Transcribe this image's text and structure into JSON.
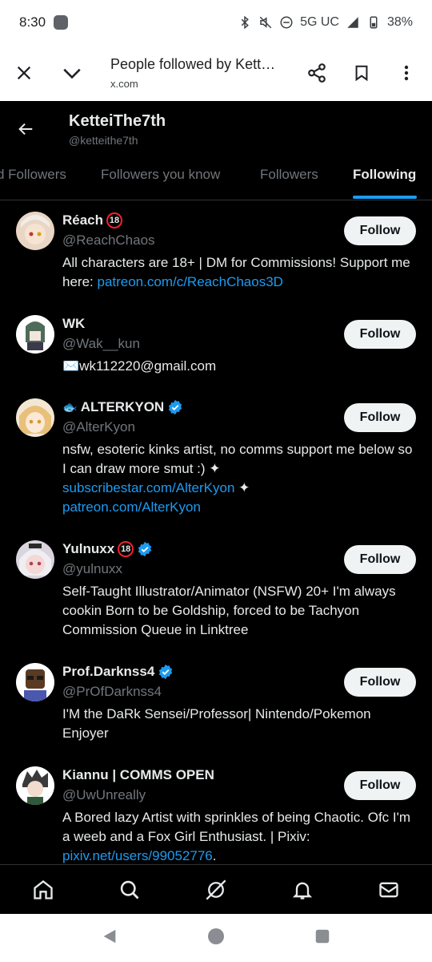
{
  "status_bar": {
    "time": "8:30",
    "network": "5G UC",
    "battery": "38%"
  },
  "browser": {
    "title": "People followed by Kett…",
    "url": "x.com"
  },
  "header": {
    "name": "KetteiThe7th",
    "handle": "@ketteithe7th"
  },
  "tabs": [
    {
      "label": "d Followers",
      "active": false
    },
    {
      "label": "Followers you know",
      "active": false
    },
    {
      "label": "Followers",
      "active": false
    },
    {
      "label": "Following",
      "active": true
    }
  ],
  "users": [
    {
      "name": "Réach",
      "badge18": "18",
      "verified": false,
      "handle": "@ReachChaos",
      "bio": "All characters are 18+ | DM for Commissions! Support me here: ",
      "bio_link": "patreon.com/c/ReachChaos3D",
      "follow_label": "Follow"
    },
    {
      "name": "WK",
      "badge18": "",
      "verified": false,
      "handle": "@Wak__kun",
      "bio": "✉️wk112220@gmail.com",
      "follow_label": "Follow"
    },
    {
      "name": "ALTERKYON",
      "name_prefix": "🐟",
      "verified": true,
      "handle": "@AlterKyon",
      "bio": "nsfw, esoteric kinks artist, no comms support me below so I can draw more smut :) ✦",
      "bio_link_1": "subscribestar.com/AlterKyon",
      "bio_sep": " ✦",
      "bio_link_2": "patreon.com/AlterKyon",
      "follow_label": "Follow"
    },
    {
      "name": "Yulnuxx",
      "badge18": "18",
      "verified": true,
      "handle": "@yulnuxx",
      "bio": "Self-Taught Illustrator/Animator (NSFW) 20+ I'm always cookin Born to be Goldship, forced to be Tachyon Commission Queue in Linktree",
      "follow_label": "Follow"
    },
    {
      "name": "Prof.Darknss4",
      "verified": true,
      "handle": "@PrOfDarknss4",
      "bio": "I'M the DaRk Sensei/Professor| Nintendo/Pokemon Enjoyer",
      "follow_label": "Follow"
    },
    {
      "name": "Kiannu | COMMS OPEN",
      "verified": false,
      "handle": "@UwUnreally",
      "bio": "A Bored lazy Artist with sprinkles of being Chaotic. Ofc I'm a weeb and a Fox Girl Enthusiast. | Pixiv: ",
      "bio_link": "pixiv.net/users/99052776",
      "bio_end": ".",
      "follow_label": "Follow"
    }
  ],
  "colors": {
    "accent": "#1d9bf0",
    "background": "#000000",
    "text": "#e7e9ea",
    "muted": "#71767b",
    "badge_red": "#f4212e"
  }
}
